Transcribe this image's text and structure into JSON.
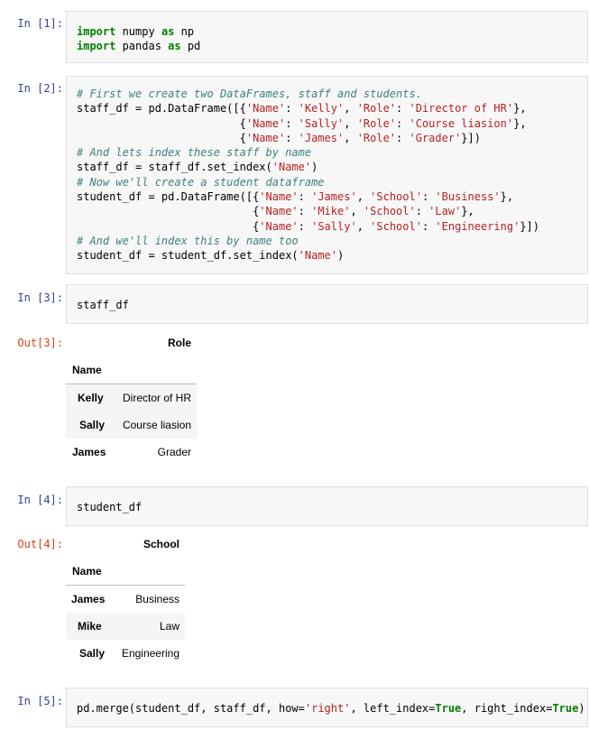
{
  "cells": [
    {
      "prompt": "In [1]:",
      "code_lines": [
        [
          [
            "kw",
            "import"
          ],
          [
            "nb",
            " numpy "
          ],
          [
            "kw",
            "as"
          ],
          [
            "nb",
            " np"
          ]
        ],
        [
          [
            "kw",
            "import"
          ],
          [
            "nb",
            " pandas "
          ],
          [
            "kw",
            "as"
          ],
          [
            "nb",
            " pd"
          ]
        ]
      ]
    },
    {
      "prompt": "In [2]:",
      "code_lines": [
        [
          [
            "cm",
            "# First we create two DataFrames, staff and students."
          ]
        ],
        [
          [
            "nb",
            "staff_df = pd.DataFrame([{"
          ],
          [
            "st",
            "'Name'"
          ],
          [
            "nb",
            ": "
          ],
          [
            "st",
            "'Kelly'"
          ],
          [
            "nb",
            ", "
          ],
          [
            "st",
            "'Role'"
          ],
          [
            "nb",
            ": "
          ],
          [
            "st",
            "'Director of HR'"
          ],
          [
            "nb",
            "},"
          ]
        ],
        [
          [
            "nb",
            "                         {"
          ],
          [
            "st",
            "'Name'"
          ],
          [
            "nb",
            ": "
          ],
          [
            "st",
            "'Sally'"
          ],
          [
            "nb",
            ", "
          ],
          [
            "st",
            "'Role'"
          ],
          [
            "nb",
            ": "
          ],
          [
            "st",
            "'Course liasion'"
          ],
          [
            "nb",
            "},"
          ]
        ],
        [
          [
            "nb",
            "                         {"
          ],
          [
            "st",
            "'Name'"
          ],
          [
            "nb",
            ": "
          ],
          [
            "st",
            "'James'"
          ],
          [
            "nb",
            ", "
          ],
          [
            "st",
            "'Role'"
          ],
          [
            "nb",
            ": "
          ],
          [
            "st",
            "'Grader'"
          ],
          [
            "nb",
            "}])"
          ]
        ],
        [
          [
            "cm",
            "# And lets index these staff by name"
          ]
        ],
        [
          [
            "nb",
            "staff_df = staff_df.set_index("
          ],
          [
            "st",
            "'Name'"
          ],
          [
            "nb",
            ")"
          ]
        ],
        [
          [
            "cm",
            "# Now we'll create a student dataframe"
          ]
        ],
        [
          [
            "nb",
            "student_df = pd.DataFrame([{"
          ],
          [
            "st",
            "'Name'"
          ],
          [
            "nb",
            ": "
          ],
          [
            "st",
            "'James'"
          ],
          [
            "nb",
            ", "
          ],
          [
            "st",
            "'School'"
          ],
          [
            "nb",
            ": "
          ],
          [
            "st",
            "'Business'"
          ],
          [
            "nb",
            "},"
          ]
        ],
        [
          [
            "nb",
            "                           {"
          ],
          [
            "st",
            "'Name'"
          ],
          [
            "nb",
            ": "
          ],
          [
            "st",
            "'Mike'"
          ],
          [
            "nb",
            ", "
          ],
          [
            "st",
            "'School'"
          ],
          [
            "nb",
            ": "
          ],
          [
            "st",
            "'Law'"
          ],
          [
            "nb",
            "},"
          ]
        ],
        [
          [
            "nb",
            "                           {"
          ],
          [
            "st",
            "'Name'"
          ],
          [
            "nb",
            ": "
          ],
          [
            "st",
            "'Sally'"
          ],
          [
            "nb",
            ", "
          ],
          [
            "st",
            "'School'"
          ],
          [
            "nb",
            ": "
          ],
          [
            "st",
            "'Engineering'"
          ],
          [
            "nb",
            "}])"
          ]
        ],
        [
          [
            "cm",
            "# And we'll index this by name too"
          ]
        ],
        [
          [
            "nb",
            "student_df = student_df.set_index("
          ],
          [
            "st",
            "'Name'"
          ],
          [
            "nb",
            ")"
          ]
        ]
      ]
    },
    {
      "prompt": "In [3]:",
      "code_lines": [
        [
          [
            "nb",
            "staff_df"
          ]
        ]
      ]
    },
    {
      "prompt": "In [4]:",
      "code_lines": [
        [
          [
            "nb",
            "student_df"
          ]
        ]
      ]
    },
    {
      "prompt": "In [5]:",
      "code_lines": [
        [
          [
            "nb",
            "pd.merge(student_df, staff_df, how="
          ],
          [
            "st",
            "'right'"
          ],
          [
            "nb",
            ", left_index="
          ],
          [
            "kw",
            "True"
          ],
          [
            "nb",
            ", right_index="
          ],
          [
            "kw",
            "True"
          ],
          [
            "nb",
            ")"
          ]
        ]
      ]
    }
  ],
  "outputs": [
    {
      "prompt": "Out[3]:",
      "column": "Role",
      "index_name": "Name",
      "rows": [
        {
          "index": "Kelly",
          "value": "Director of HR"
        },
        {
          "index": "Sally",
          "value": "Course liasion"
        },
        {
          "index": "James",
          "value": "Grader"
        }
      ]
    },
    {
      "prompt": "Out[4]:",
      "column": "School",
      "index_name": "Name",
      "rows": [
        {
          "index": "James",
          "value": "Business"
        },
        {
          "index": "Mike",
          "value": "Law"
        },
        {
          "index": "Sally",
          "value": "Engineering"
        }
      ]
    }
  ]
}
